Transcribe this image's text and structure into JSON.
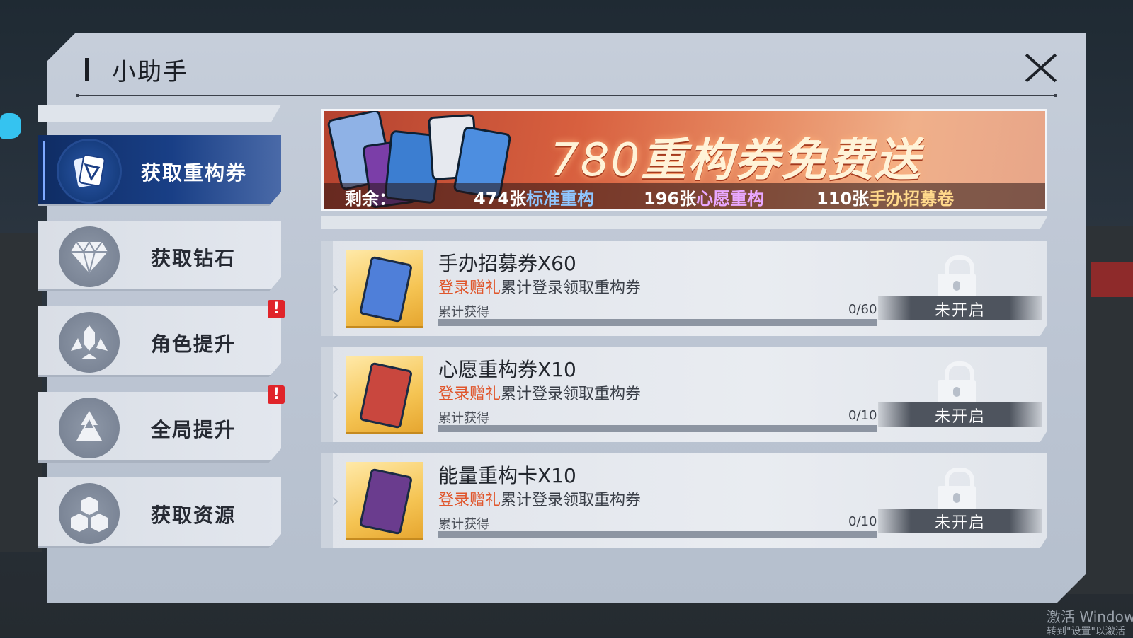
{
  "window": {
    "title": "小助手"
  },
  "sidebar": {
    "items": [
      {
        "label": "获取重构券",
        "icon": "card-icon",
        "active": true,
        "badge": ""
      },
      {
        "label": "获取钻石",
        "icon": "diamond-icon",
        "active": false,
        "badge": ""
      },
      {
        "label": "角色提升",
        "icon": "character-icon",
        "active": false,
        "badge": "!"
      },
      {
        "label": "全局提升",
        "icon": "mountain-icon",
        "active": false,
        "badge": "!"
      },
      {
        "label": "获取资源",
        "icon": "cubes-icon",
        "active": false,
        "badge": ""
      }
    ]
  },
  "banner": {
    "number": "780",
    "headline": "重构券免费送",
    "remaining_label": "剩余：",
    "std_count": "474张",
    "std_label": "标准重构",
    "wish_count": "196张",
    "wish_label": "心愿重构",
    "fig_count": "110张",
    "fig_label": "手办招募卷"
  },
  "rewards": [
    {
      "name": "手办招募券X60",
      "tag": "登录赠礼",
      "desc": "累计登录领取重构券",
      "progress_label": "累计获得",
      "progress_text": "0/60",
      "progress": 0,
      "status": "未开启",
      "card_color": "#4f7fd9"
    },
    {
      "name": "心愿重构券X10",
      "tag": "登录赠礼",
      "desc": "累计登录领取重构券",
      "progress_label": "累计获得",
      "progress_text": "0/10",
      "progress": 0,
      "status": "未开启",
      "card_color": "#c9473e"
    },
    {
      "name": "能量重构卡X10",
      "tag": "登录赠礼",
      "desc": "累计登录领取重构券",
      "progress_label": "累计获得",
      "progress_text": "0/10",
      "progress": 0,
      "status": "未开启",
      "card_color": "#6a3c8e"
    }
  ],
  "os_watermark": {
    "line1": "激活 Window",
    "line2": "转到\"设置\"以激活"
  }
}
